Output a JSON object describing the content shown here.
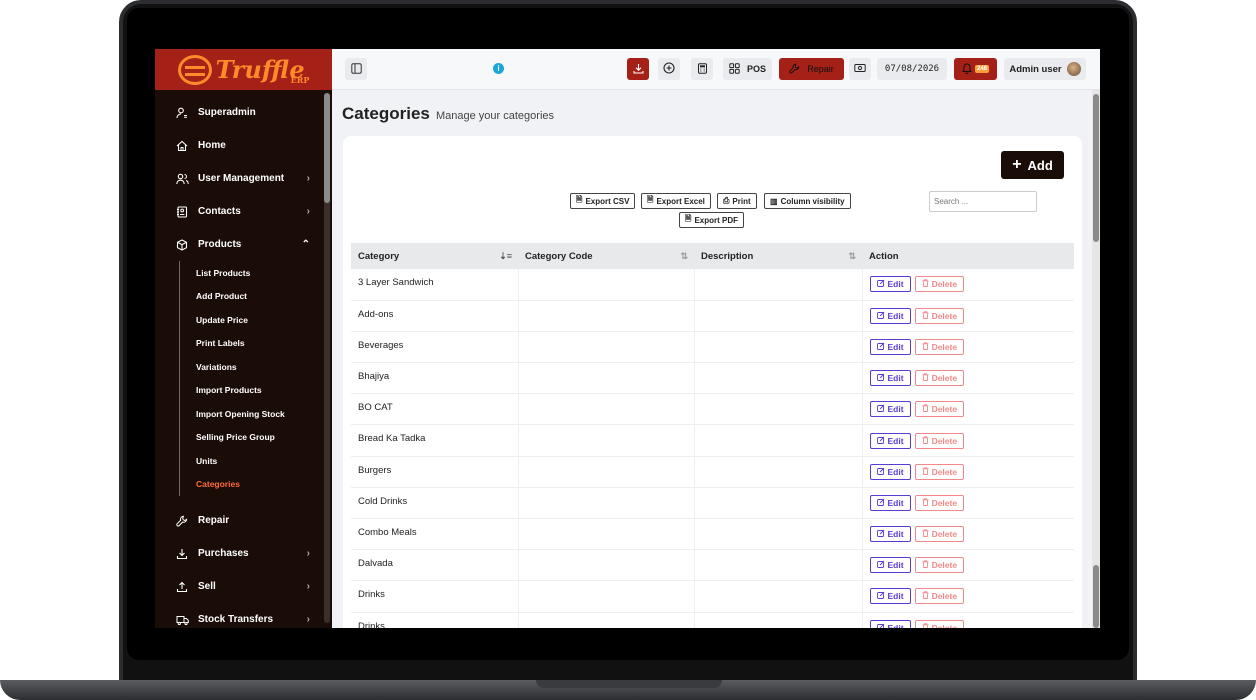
{
  "brand": {
    "logo_text": "Truffle",
    "logo_sub": "ERP"
  },
  "sidebar": {
    "items": [
      {
        "label": "Superadmin",
        "icon": "user-icon",
        "chevron": ""
      },
      {
        "label": "Home",
        "icon": "home-icon",
        "chevron": ""
      },
      {
        "label": "User Management",
        "icon": "users-icon",
        "chevron": "›"
      },
      {
        "label": "Contacts",
        "icon": "contacts-icon",
        "chevron": "›"
      },
      {
        "label": "Products",
        "icon": "box-icon",
        "chevron": "⌃"
      }
    ],
    "products_submenu": [
      "List Products",
      "Add Product",
      "Update Price",
      "Print Labels",
      "Variations",
      "Import Products",
      "Import Opening Stock",
      "Selling Price Group",
      "Units",
      "Categories"
    ],
    "active_sub": "Categories",
    "items_after": [
      {
        "label": "Repair",
        "icon": "wrench-icon",
        "chevron": ""
      },
      {
        "label": "Purchases",
        "icon": "download-icon",
        "chevron": "›"
      },
      {
        "label": "Sell",
        "icon": "upload-icon",
        "chevron": "›"
      },
      {
        "label": "Stock Transfers",
        "icon": "truck-icon",
        "chevron": "›"
      }
    ]
  },
  "topbar": {
    "info": "i",
    "pos_label": "POS",
    "repair_label": "Repair",
    "date": "07/08/2026",
    "notification_count": "248",
    "user_label": "Admin user"
  },
  "page": {
    "title": "Categories",
    "subtitle": "Manage your categories",
    "add_label": "Add"
  },
  "toolbar": {
    "export_csv": "Export CSV",
    "export_excel": "Export Excel",
    "print": "Print",
    "column_visibility": "Column visibility",
    "export_pdf": "Export PDF",
    "search_placeholder": "Search ..."
  },
  "table": {
    "columns": [
      "Category",
      "Category Code",
      "Description",
      "Action"
    ],
    "edit_label": "Edit",
    "delete_label": "Delete",
    "rows": [
      "3 Layer Sandwich",
      "Add-ons",
      "Beverages",
      "Bhajiya",
      "BO CAT",
      "Bread Ka Tadka",
      "Burgers",
      "Cold Drinks",
      "Combo Meals",
      "Dalvada",
      "Drinks",
      "Drinks"
    ]
  },
  "colors": {
    "brand_red": "#a52017",
    "sidebar_bg": "#1a0d07",
    "active_link": "#ff6a3d",
    "edit": "#5b3bd6",
    "delete": "#f08a8a"
  }
}
